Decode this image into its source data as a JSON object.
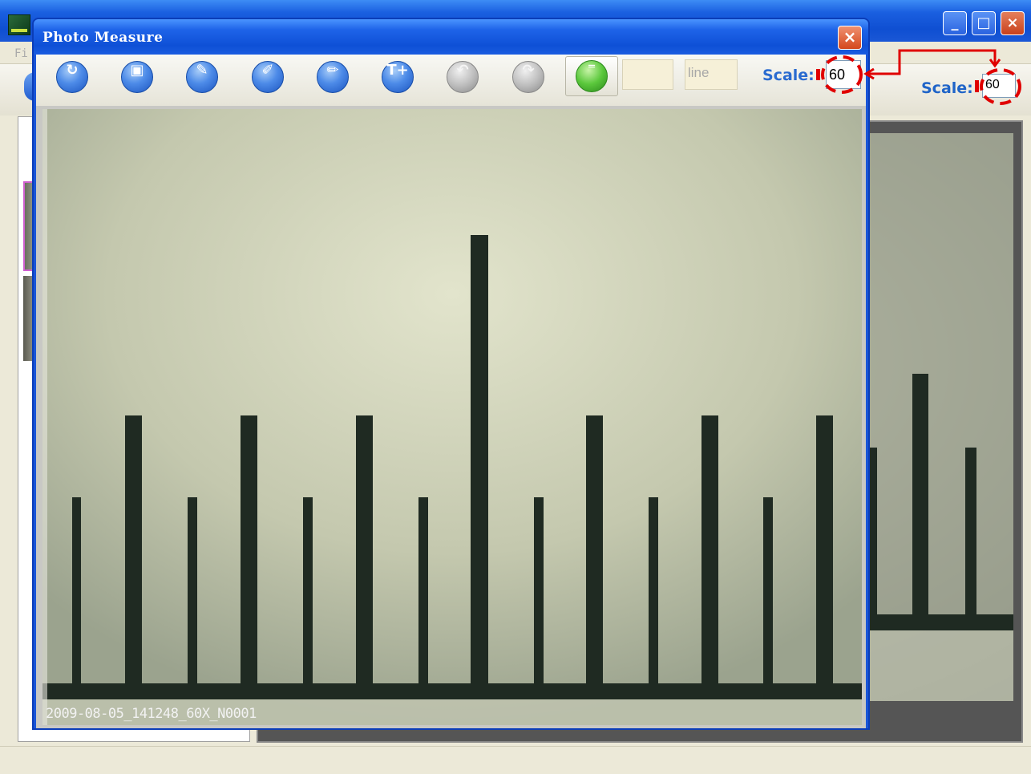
{
  "main_window": {
    "menu": {
      "file_partial": "Fi"
    },
    "scale": {
      "label": "Scale:",
      "value": "60"
    },
    "window_controls": {
      "minimize": "_",
      "maximize": "□",
      "close": "×"
    }
  },
  "photo_measure": {
    "title": "Photo Measure",
    "close": "×",
    "toolbar": {
      "buttons": [
        {
          "name": "open-icon",
          "glyph": "↻"
        },
        {
          "name": "save-icon",
          "glyph": "▣"
        },
        {
          "name": "edit-icon",
          "glyph": "✎"
        },
        {
          "name": "ruler-calibrate-icon",
          "glyph": "✐"
        },
        {
          "name": "pencil-icon",
          "glyph": "✏"
        },
        {
          "name": "text-icon",
          "glyph": "T+"
        },
        {
          "name": "undo-icon",
          "glyph": "↶"
        },
        {
          "name": "redo-icon",
          "glyph": "↷"
        }
      ],
      "value_input": "",
      "unit_placeholder": "line",
      "scale_label": "Scale:",
      "scale_value": "60"
    },
    "image_caption": "2009-08-05_141248_60X_N0001"
  },
  "annotation_color": "#e00000"
}
